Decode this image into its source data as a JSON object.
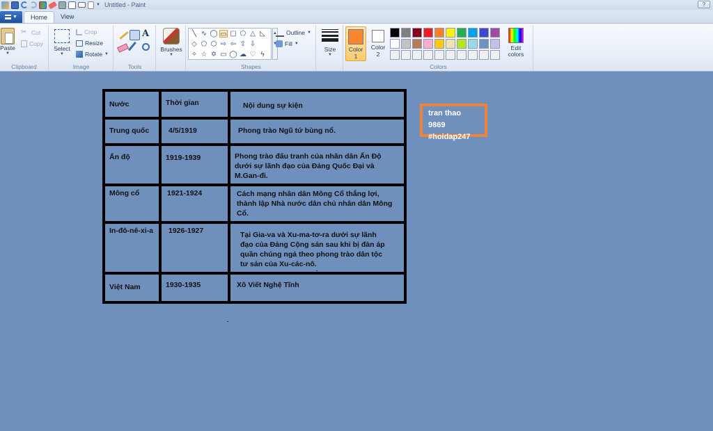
{
  "window": {
    "title": "Untitled - Paint",
    "qat_icons": [
      "save-icon",
      "undo-icon",
      "redo-icon",
      "paint-icon",
      "eraser-icon",
      "print-icon",
      "print-preview-icon",
      "email-icon",
      "new-icon",
      "customize-icon"
    ]
  },
  "tabs": {
    "home": "Home",
    "view": "View"
  },
  "clipboard": {
    "paste": "Paste",
    "cut": "Cut",
    "copy": "Copy",
    "label": "Clipboard"
  },
  "image": {
    "select": "Select",
    "crop": "Crop",
    "resize": "Resize",
    "rotate": "Rotate",
    "label": "Image"
  },
  "tools": {
    "label": "Tools"
  },
  "brushes": {
    "label": "Brushes"
  },
  "shapes": {
    "outline": "Outline",
    "fill": "Fill",
    "label": "Shapes"
  },
  "size": {
    "label": "Size"
  },
  "colors": {
    "label": "Colors",
    "color1_word": "Color",
    "color1_num": "1",
    "color2_word": "Color",
    "color2_num": "2",
    "edit_line1": "Edit",
    "edit_line2": "colors",
    "color1": "#f7862e",
    "color2": "#ffffff",
    "palette": [
      "#000000",
      "#7f7f7f",
      "#880015",
      "#ed1c24",
      "#ff7f27",
      "#fff200",
      "#22b14c",
      "#00a2e8",
      "#3f48cc",
      "#a349a4",
      "#ffffff",
      "#c3c3c3",
      "#b97a57",
      "#ffaec9",
      "#ffc90e",
      "#efe4b0",
      "#b5e61d",
      "#99d9ea",
      "#7092be",
      "#c8bfe7",
      "#f0f0f0",
      "#f0f0f0",
      "#f0f0f0",
      "#f0f0f0",
      "#f0f0f0",
      "#f0f0f0",
      "#f0f0f0",
      "#f0f0f0",
      "#f0f0f0",
      "#f0f0f0"
    ]
  },
  "canvas": {
    "background": "#6f8fbd",
    "table": {
      "headers": [
        "Nước",
        "Thời gian",
        "Nội dung sự kiện"
      ],
      "rows": [
        [
          "Trung quốc",
          "4/5/1919",
          "Phong trào Ngũ tứ bùng nổ."
        ],
        [
          "Ấn độ",
          "1919-1939",
          "Phong trào đấu tranh của nhân dân Ấn Độ dưới sự lãnh đạo của Đảng Quốc Đại và M.Gan-đi."
        ],
        [
          "Mông cổ",
          "1921-1924",
          "Cách mạng nhân dân Mông Cổ thắng lợi, thành lập Nhà nước dân chủ nhân dân Mông Cổ."
        ],
        [
          "In-đô-nê-xi-a",
          "1926-1927",
          "Tại Gia-va và Xu-ma-tơ-ra dưới sự lãnh đạo của Đảng Cộng sản sau khi bị đàn áp quần chúng ngả theo phong trào dân tộc tư sản của Xu-các-nô."
        ],
        [
          "Việt Nam",
          "1930-1935",
          "Xô Viết Nghệ Tĩnh"
        ]
      ]
    },
    "watermark": {
      "line1": "tran thao 9869",
      "line2": "#hoidap247",
      "border_color": "#f0833a"
    }
  }
}
